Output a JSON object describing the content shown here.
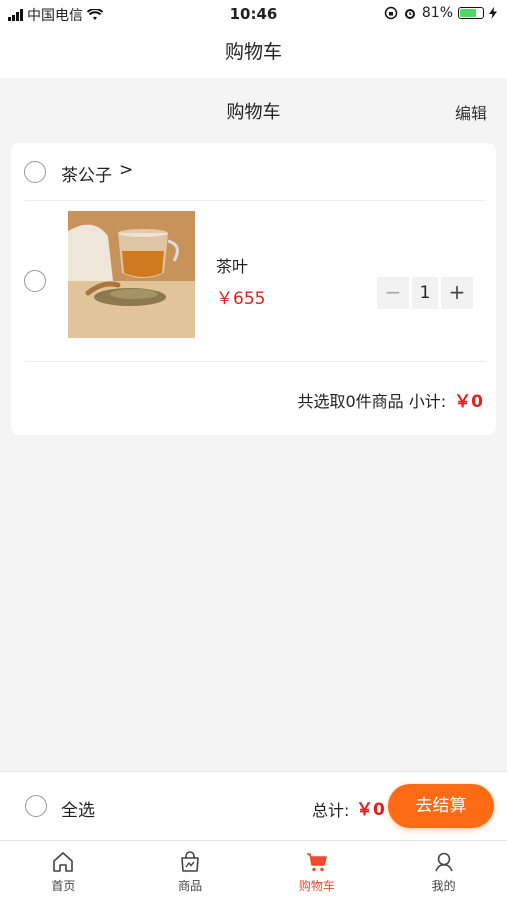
{
  "status_bar": {
    "carrier": "中国电信",
    "time": "10:46",
    "battery": "81%",
    "battery_level": 0.81
  },
  "navbar": {
    "title": "购物车"
  },
  "subheader": {
    "title": "购物车",
    "edit_label": "编辑"
  },
  "shop": {
    "name": "茶公子",
    "arrow": ">",
    "items": [
      {
        "name": "茶叶",
        "price": "￥655",
        "quantity": "1",
        "minus": "−",
        "plus": "+"
      }
    ],
    "subtotal_label": "共选取0件商品  小计:",
    "subtotal_value": "￥0"
  },
  "bottom": {
    "select_all_label": "全选",
    "total_label": "总计:",
    "total_value": "￥0",
    "checkout_label": "去结算"
  },
  "tabs": [
    {
      "label": "首页",
      "icon": "home-icon"
    },
    {
      "label": "商品",
      "icon": "bag-icon"
    },
    {
      "label": "购物车",
      "icon": "cart-icon",
      "active": true
    },
    {
      "label": "我的",
      "icon": "user-icon"
    }
  ],
  "colors": {
    "accent": "#ff6b15",
    "price": "#e02020",
    "active_tab": "#f04a2a"
  }
}
